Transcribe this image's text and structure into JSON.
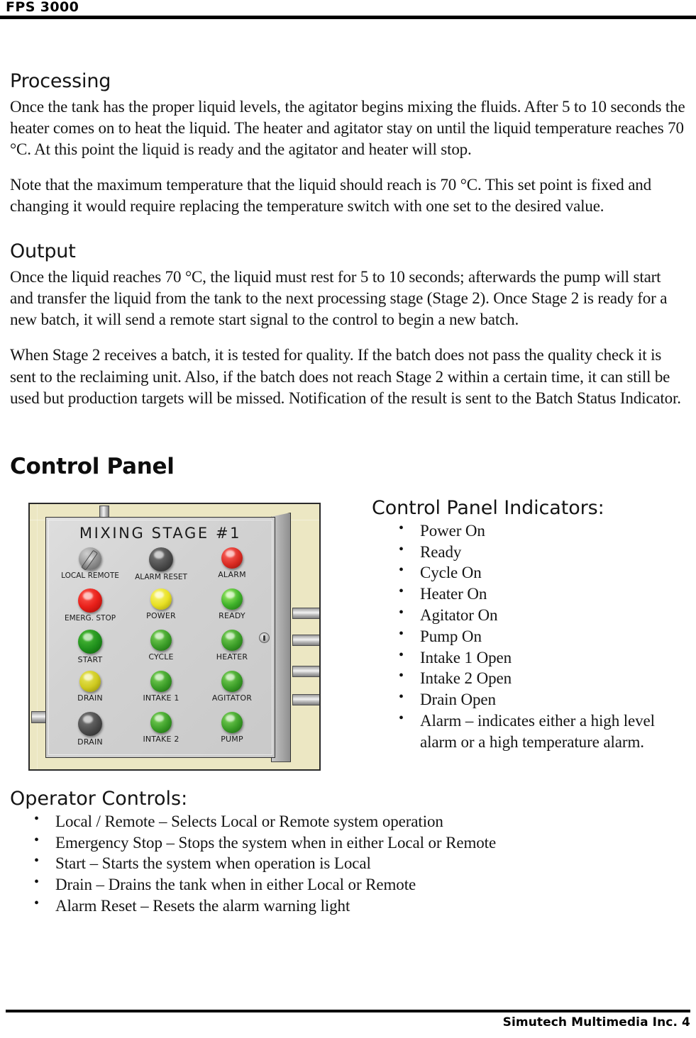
{
  "header": {
    "title": "FPS 3000"
  },
  "sections": {
    "processing": {
      "heading": "Processing",
      "paragraph_1": "Once the tank has the proper liquid levels, the agitator begins mixing the fluids. After 5 to 10 seconds the heater comes on to heat the liquid. The heater and agitator stay on until the liquid temperature reaches 70 °C. At this point the liquid is ready and the agitator and heater will stop.",
      "paragraph_2": "Note that the maximum temperature that the liquid should reach is 70 °C. This set point is fixed and changing it would require replacing the temperature switch with one set to the desired value."
    },
    "output": {
      "heading": "Output",
      "paragraph_1": "Once the liquid reaches 70 °C, the liquid must rest for 5 to 10 seconds; afterwards the pump will start and transfer the liquid from the tank to the next processing stage (Stage 2). Once Stage 2 is ready for a new batch, it will send a remote start signal to the control to begin a new batch.",
      "paragraph_2": "When Stage 2 receives a batch, it is tested for quality. If the batch does not pass the quality check it is sent to the reclaiming unit. Also, if the batch does not reach Stage 2 within a certain time, it can still be used but production targets will be missed. Notification of the result is sent to the Batch Status Indicator."
    },
    "control_panel": {
      "heading": "Control Panel"
    }
  },
  "panel_figure": {
    "panel_title": "MIXING STAGE #1",
    "controls": [
      {
        "label": "LOCAL  REMOTE",
        "type": "selector",
        "color": "#8e8e8e"
      },
      {
        "label": "ALARM RESET",
        "type": "button",
        "color": "#4a4a4a"
      },
      {
        "label": "ALARM",
        "type": "lamp",
        "color": "#d92a22"
      },
      {
        "label": "EMERG. STOP",
        "type": "button",
        "color": "#e8201a"
      },
      {
        "label": "POWER",
        "type": "lamp",
        "color": "#e8e024"
      },
      {
        "label": "READY",
        "type": "lamp",
        "color": "#3fb22a"
      },
      {
        "label": "START",
        "type": "button",
        "color": "#1f8f1c"
      },
      {
        "label": "CYCLE",
        "type": "lamp",
        "color": "#3a9c27"
      },
      {
        "label": "HEATER",
        "type": "lamp",
        "color": "#3a9c27"
      },
      {
        "label": "DRAIN",
        "type": "button",
        "color": "#cfca20"
      },
      {
        "label": "INTAKE 1",
        "type": "lamp",
        "color": "#3a9c27"
      },
      {
        "label": "AGITATOR",
        "type": "lamp",
        "color": "#3a9c27"
      },
      {
        "label": "DRAIN",
        "type": "button",
        "color": "#4a4a4a"
      },
      {
        "label": "INTAKE 2",
        "type": "lamp",
        "color": "#3a9c27"
      },
      {
        "label": "PUMP",
        "type": "lamp",
        "color": "#3a9c27"
      }
    ],
    "enclosure_color": "#d2d2d2",
    "wall_color": "#ece7c3"
  },
  "indicators": {
    "title": "Control Panel Indicators:",
    "items": [
      "Power On",
      "Ready",
      "Cycle On",
      "Heater On",
      "Agitator On",
      "Pump On",
      "Intake 1 Open",
      "Intake 2 Open",
      "Drain Open",
      "Alarm – indicates either a high level alarm or a high temperature alarm."
    ]
  },
  "operator_controls": {
    "title": "Operator Controls:",
    "items": [
      "Local / Remote – Selects Local or Remote system operation",
      "Emergency Stop – Stops the system when in either Local or Remote",
      "Start – Starts the system when operation is Local",
      "Drain – Drains the tank when in either Local or Remote",
      "Alarm Reset – Resets the alarm warning light"
    ]
  },
  "footer": {
    "text": "Simutech Multimedia Inc. 4"
  }
}
